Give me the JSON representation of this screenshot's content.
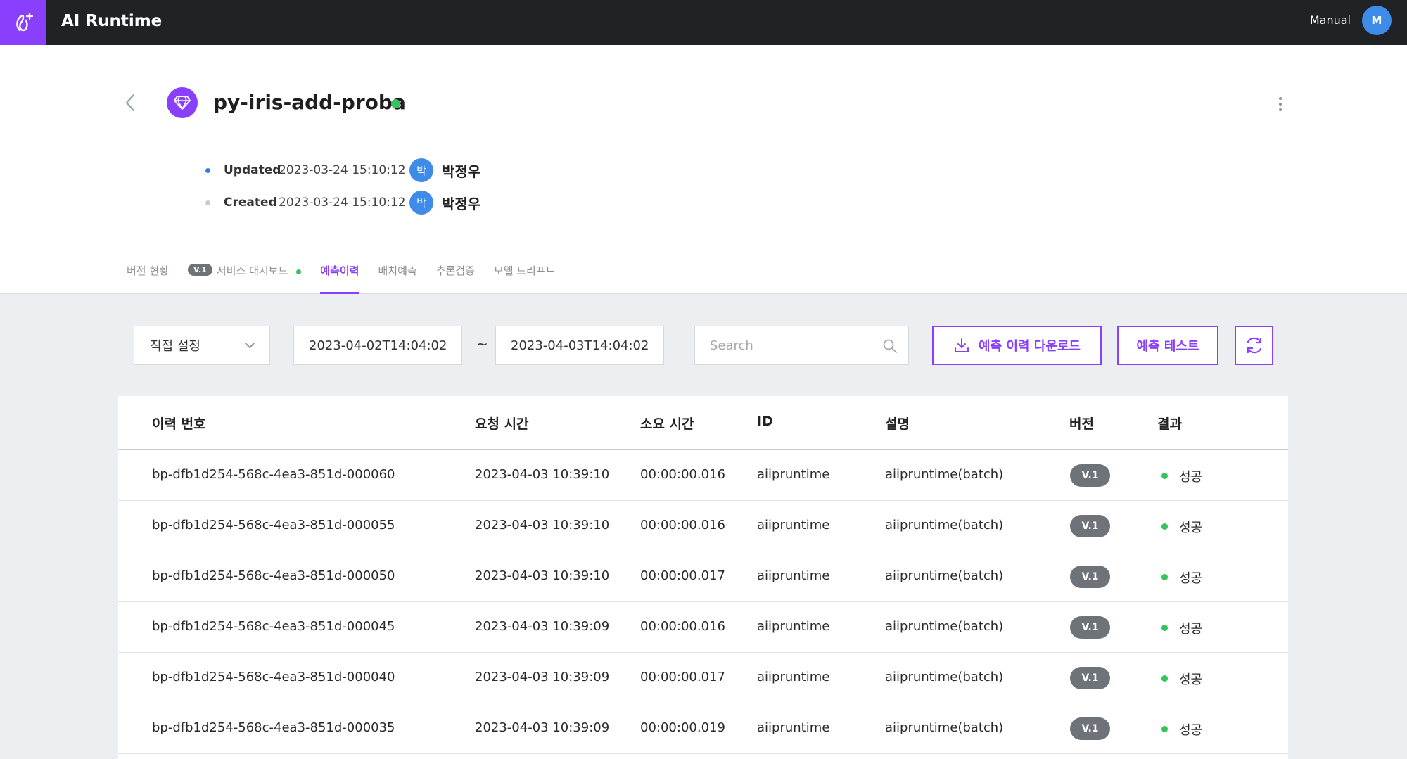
{
  "app": {
    "title": "AI Runtime",
    "manual_label": "Manual",
    "user_initial": "M"
  },
  "colors": {
    "accent": "#8a3ffc",
    "topbar": "#212226",
    "success": "#35c35b",
    "avatar": "#3e8ce8",
    "badge": "#6e7279"
  },
  "model": {
    "name": "py-iris-add-proba",
    "status": "active"
  },
  "meta": {
    "updated": {
      "label": "Updated",
      "time": "2023-03-24 15:10:12",
      "avatar": "박",
      "user": "박정우"
    },
    "created": {
      "label": "Created",
      "time": "2023-03-24 15:10:12",
      "avatar": "박",
      "user": "박정우"
    }
  },
  "tabs": [
    {
      "label": "버전 현황"
    },
    {
      "badge": "V.1",
      "label": "서비스 대시보드"
    },
    {
      "label": "예측이력",
      "active": true
    },
    {
      "label": "배치예측"
    },
    {
      "label": "추론검증"
    },
    {
      "label": "모델 드리프트"
    }
  ],
  "filters": {
    "range_select": "직접 설정",
    "start_date": "2023-04-02T14:04:02",
    "tilde": "~",
    "end_date": "2023-04-03T14:04:02",
    "search_placeholder": "Search",
    "download_label": "예측 이력 다운로드",
    "test_label": "예측 테스트"
  },
  "table": {
    "columns": [
      "이력 번호",
      "요청 시간",
      "소요 시간",
      "ID",
      "설명",
      "버전",
      "결과"
    ],
    "rows": [
      {
        "history_no": "bp-dfb1d254-568c-4ea3-851d-000060",
        "request_time": "2023-04-03 10:39:10",
        "elapsed": "00:00:00.016",
        "id": "aiipruntime",
        "desc": "aiipruntime(batch)",
        "version": "V.1",
        "result": "성공"
      },
      {
        "history_no": "bp-dfb1d254-568c-4ea3-851d-000055",
        "request_time": "2023-04-03 10:39:10",
        "elapsed": "00:00:00.016",
        "id": "aiipruntime",
        "desc": "aiipruntime(batch)",
        "version": "V.1",
        "result": "성공"
      },
      {
        "history_no": "bp-dfb1d254-568c-4ea3-851d-000050",
        "request_time": "2023-04-03 10:39:10",
        "elapsed": "00:00:00.017",
        "id": "aiipruntime",
        "desc": "aiipruntime(batch)",
        "version": "V.1",
        "result": "성공"
      },
      {
        "history_no": "bp-dfb1d254-568c-4ea3-851d-000045",
        "request_time": "2023-04-03 10:39:09",
        "elapsed": "00:00:00.016",
        "id": "aiipruntime",
        "desc": "aiipruntime(batch)",
        "version": "V.1",
        "result": "성공"
      },
      {
        "history_no": "bp-dfb1d254-568c-4ea3-851d-000040",
        "request_time": "2023-04-03 10:39:09",
        "elapsed": "00:00:00.017",
        "id": "aiipruntime",
        "desc": "aiipruntime(batch)",
        "version": "V.1",
        "result": "성공"
      },
      {
        "history_no": "bp-dfb1d254-568c-4ea3-851d-000035",
        "request_time": "2023-04-03 10:39:09",
        "elapsed": "00:00:00.019",
        "id": "aiipruntime",
        "desc": "aiipruntime(batch)",
        "version": "V.1",
        "result": "성공"
      }
    ]
  },
  "icons": {
    "logo": "app-logo-icon",
    "back": "chevron-left-icon",
    "model": "diamond-icon",
    "menu": "kebab-menu-icon",
    "dropdown": "chevron-down-icon",
    "search": "search-icon",
    "download": "download-icon",
    "refresh": "refresh-icon"
  }
}
